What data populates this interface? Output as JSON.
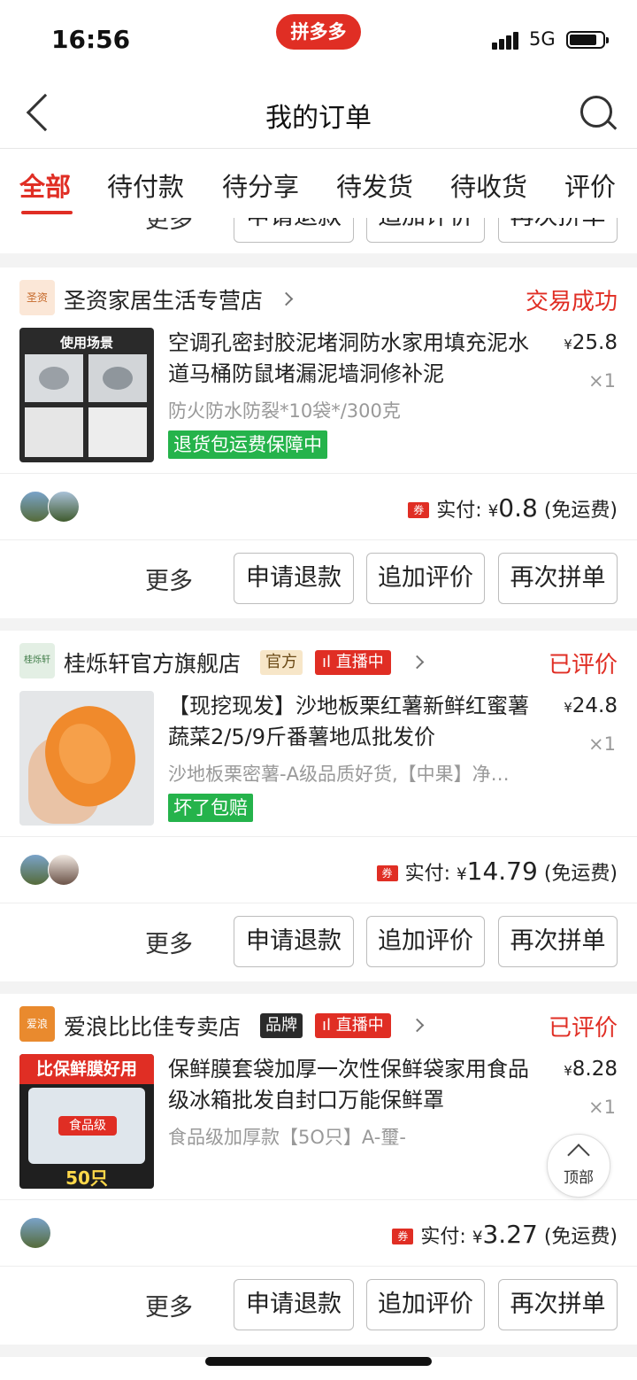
{
  "status_bar": {
    "time": "16:56",
    "app_logo": "拼多多",
    "network": "5G"
  },
  "nav": {
    "title": "我的订单"
  },
  "tabs": [
    "全部",
    "待付款",
    "待分享",
    "待发货",
    "待收货",
    "评价"
  ],
  "actions": {
    "more": "更多",
    "refund": "申请退款",
    "add_review": "追加评价",
    "reorder": "再次拼单"
  },
  "colors": {
    "accent": "#e02e24",
    "guarantee_green": "#25b34b"
  },
  "orders": [
    {
      "store_logo": "圣资",
      "store_name": "圣资家居生活专营店",
      "status": "交易成功",
      "thumb_caption": "使用场景",
      "title": "空调孔密封胶泥堵洞防水家用填充泥水道马桶防鼠堵漏泥墙洞修补泥",
      "price": "25.8",
      "qty": "×1",
      "spec": "防火防水防裂*10袋*/300克",
      "tag": "退货包运费保障中",
      "pay_label": "实付:",
      "pay_amount": "0.8",
      "pay_note": "(免运费)"
    },
    {
      "store_logo": "桂烁轩",
      "store_name": "桂烁轩官方旗舰店",
      "badge": "官方",
      "live": "直播中",
      "status": "已评价",
      "title": "【现挖现发】沙地板栗红薯新鲜红蜜薯蔬菜2/5/9斤番薯地瓜批发价",
      "price": "24.8",
      "qty": "×1",
      "spec": "沙地板栗密薯-A级品质好货,【中果】净…",
      "tag": "坏了包赔",
      "pay_label": "实付:",
      "pay_amount": "14.79",
      "pay_note": "(免运费)"
    },
    {
      "store_logo": "爱浪",
      "store_name": "爱浪比比佳专卖店",
      "badge": "品牌",
      "live": "直播中",
      "status": "已评价",
      "thumb_caption_top": "比保鲜膜好用",
      "thumb_caption_label": "食品级",
      "thumb_caption_bottom": "50只",
      "title": "保鲜膜套袋加厚一次性保鲜袋家用食品级冰箱批发自封口万能保鲜罩",
      "price": "8.28",
      "qty": "×1",
      "spec": "食品级加厚款【5O只】A-璽-",
      "pay_label": "实付:",
      "pay_amount": "3.27",
      "pay_note": "(免运费)"
    }
  ],
  "currency": "¥",
  "coupon_icon": "券",
  "to_top": "顶部"
}
